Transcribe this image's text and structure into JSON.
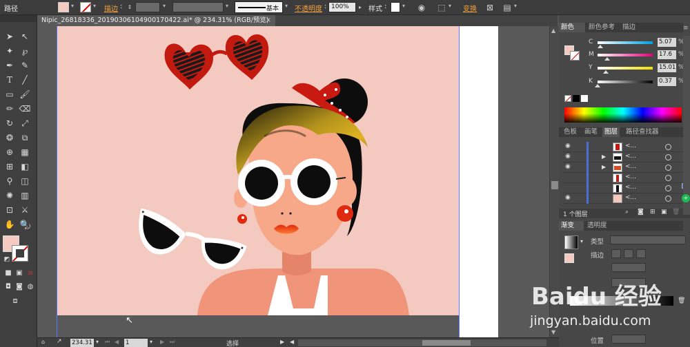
{
  "control_bar": {
    "path_label": "路径",
    "stroke_label": "描边",
    "stroke_profile": "基本",
    "opacity_label": "不透明度",
    "opacity_value": "100%",
    "style_label": "样式",
    "transform_label": "变换",
    "fill_color": "#f5cbc1"
  },
  "document_tab": {
    "title": "Nipic_26818336_20190306104900170422.ai* @ 234.31% (RGB/预览)",
    "close": "×"
  },
  "color_panel": {
    "tabs": [
      "颜色",
      "颜色参考",
      "描边"
    ],
    "channels": [
      {
        "letter": "C",
        "value": "5.07",
        "unit": "%",
        "level": 0.0507
      },
      {
        "letter": "M",
        "value": "17.6",
        "unit": "%",
        "level": 0.176
      },
      {
        "letter": "Y",
        "value": "15.01",
        "unit": "%",
        "level": 0.1501
      },
      {
        "letter": "K",
        "value": "0.37",
        "unit": "%",
        "level": 0.0037
      }
    ]
  },
  "layers_panel": {
    "tabs": [
      "色板",
      "画笔",
      "图层",
      "路径查找器"
    ],
    "rows": [
      {
        "name": "<...",
        "expandable": false
      },
      {
        "name": "<...",
        "expandable": true
      },
      {
        "name": "<...",
        "expandable": true
      },
      {
        "name": "<...",
        "expandable": false
      },
      {
        "name": "<...",
        "expandable": false
      },
      {
        "name": "<...",
        "expandable": false
      }
    ],
    "footer": "1 个图层"
  },
  "gradient_panel": {
    "tabs": [
      "渐变",
      "透明度"
    ],
    "type_label": "类型",
    "stroke_label": "描边",
    "position_label": "位置"
  },
  "status_bar": {
    "zoom": "234.31",
    "page": "1",
    "tool": "选择"
  },
  "watermark": {
    "brand": "Baidu 经验",
    "url": "jingyan.baidu.com"
  }
}
